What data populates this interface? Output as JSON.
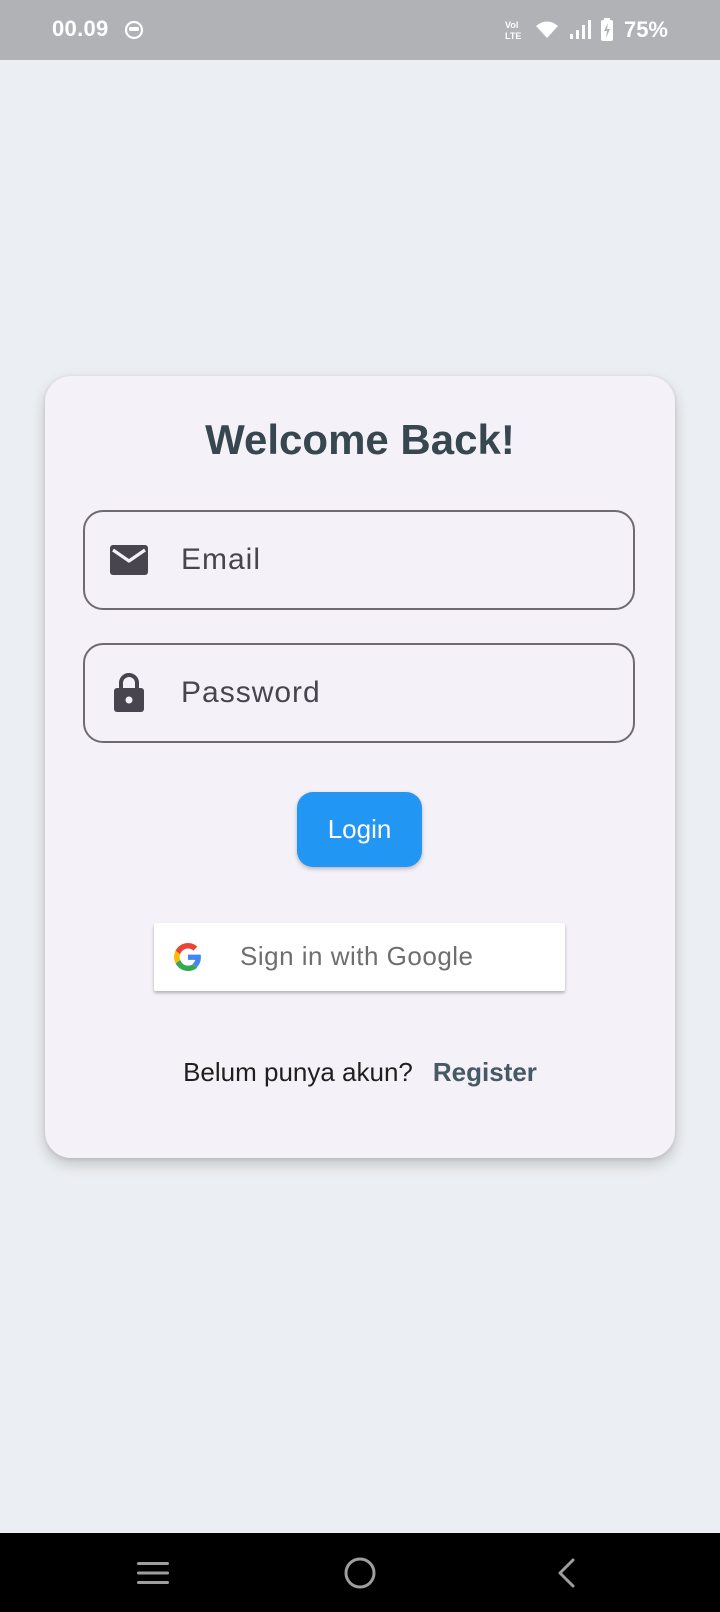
{
  "status_bar": {
    "time": "00.09",
    "app_icon": "notification-app-icon",
    "network_label": "VoLTE",
    "battery": "75%"
  },
  "login": {
    "title": "Welcome Back!",
    "email_placeholder": "Email",
    "email_icon": "mail-icon",
    "password_placeholder": "Password",
    "password_icon": "lock-icon",
    "login_label": "Login",
    "google_label": "Sign in with Google",
    "register_prompt": "Belum punya akun?",
    "register_link": "Register"
  },
  "nav_bar": {
    "menu_icon": "recent-apps-icon",
    "home_icon": "home-icon",
    "back_icon": "back-icon"
  },
  "colors": {
    "background": "#ebeef2",
    "card": "#f5f1f9",
    "title": "#37474f",
    "primary": "#2196f3",
    "register_link": "#455a64"
  }
}
